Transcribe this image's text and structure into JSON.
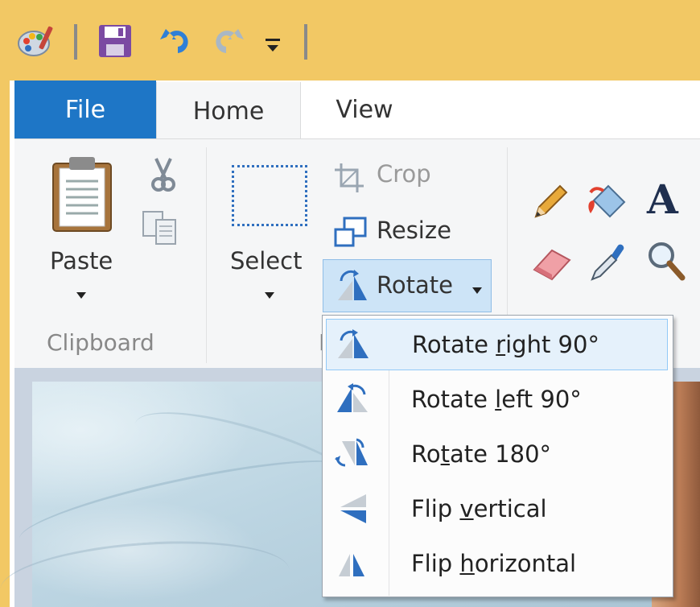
{
  "tabs": {
    "file": "File",
    "home": "Home",
    "view": "View"
  },
  "clipboard": {
    "paste_label": "Paste",
    "group_label": "Clipboard"
  },
  "image": {
    "select_label": "Select",
    "crop_label": "Crop",
    "resize_label": "Resize",
    "rotate_label": "Rotate",
    "group_label": "I"
  },
  "tools": {
    "text_glyph": "A"
  },
  "rotate_menu": {
    "items": [
      {
        "label_pre": "Rotate ",
        "label_key": "r",
        "label_post": "ight 90°",
        "icon": "rotate-right-icon",
        "highlighted": true
      },
      {
        "label_pre": "Rotate ",
        "label_key": "l",
        "label_post": "eft 90°",
        "icon": "rotate-left-icon",
        "highlighted": false
      },
      {
        "label_pre": "Ro",
        "label_key": "t",
        "label_post": "ate 180°",
        "icon": "rotate-180-icon",
        "highlighted": false
      },
      {
        "label_pre": "Flip ",
        "label_key": "v",
        "label_post": "ertical",
        "icon": "flip-vertical-icon",
        "highlighted": false
      },
      {
        "label_pre": "Flip ",
        "label_key": "h",
        "label_post": "orizontal",
        "icon": "flip-horizontal-icon",
        "highlighted": false
      }
    ]
  },
  "colors": {
    "title_bar": "#f2c864",
    "file_tab": "#1e76c6",
    "ribbon": "#f5f6f7",
    "menu_highlight": "#e5f1fb",
    "icon_blue": "#2f6fbf"
  }
}
